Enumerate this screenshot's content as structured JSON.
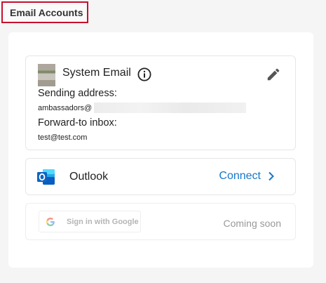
{
  "page_title": "Email Accounts",
  "system_email": {
    "title": "System Email",
    "sending_label": "Sending address:",
    "sending_value": "ambassadors@",
    "forward_label": "Forward-to inbox:",
    "forward_value": "test@test.com"
  },
  "outlook": {
    "name": "Outlook",
    "connect_label": "Connect"
  },
  "google": {
    "button_label": "Sign in with Google",
    "status": "Coming soon"
  },
  "colors": {
    "annotation_red": "#c8102e",
    "link_blue": "#1877c9",
    "outlook_blue": "#0f64c0"
  },
  "icons": [
    "info-icon",
    "pencil-icon",
    "outlook-icon",
    "chevron-right-icon",
    "google-g-icon"
  ]
}
